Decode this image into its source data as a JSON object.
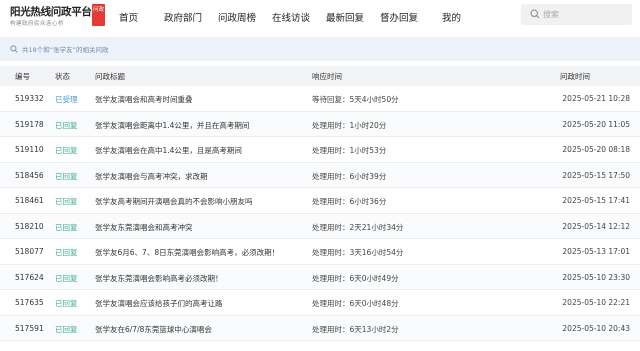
{
  "header": {
    "logo_title": "阳光热线问政平台",
    "logo_subtitle": "构建政府民众连心桥",
    "logo_seal": "问政",
    "nav": [
      {
        "label": "首页"
      },
      {
        "label": "政府部门"
      },
      {
        "label": "问政周榜"
      },
      {
        "label": "在线访谈"
      },
      {
        "label": "最新回复"
      },
      {
        "label": "督办回复"
      },
      {
        "label": "我的"
      }
    ],
    "search_placeholder": "搜索"
  },
  "notice": {
    "text": "共18个和“张学友”的相关问政"
  },
  "table": {
    "columns": [
      "编号",
      "状态",
      "问政标题",
      "响应时间",
      "问政时间"
    ],
    "rows": [
      {
        "id": "519332",
        "status": "已受理",
        "title": "张学友演唱会和高考时间重叠",
        "time": "等待回复：5天4小时50分",
        "date": "2025-05-21 10:28"
      },
      {
        "id": "519178",
        "status": "已回复",
        "title": "张学友演唱会距离中1.4公里，并且在高考期间",
        "time": "处理用时：1小时20分",
        "date": "2025-05-20 11:05"
      },
      {
        "id": "519110",
        "status": "已回复",
        "title": "张学友演唱会在高中1.4公里，且是高考期间",
        "time": "处理用时：1小时53分",
        "date": "2025-05-20 08:18"
      },
      {
        "id": "518456",
        "status": "已回复",
        "title": "张学友演唱会与高考冲突，求改期",
        "time": "处理用时：6小时39分",
        "date": "2025-05-15 17:50"
      },
      {
        "id": "518461",
        "status": "已回复",
        "title": "张学友高考期间开演唱会真的不会影响小朋友吗",
        "time": "处理用时：6小时36分",
        "date": "2025-05-15 17:41"
      },
      {
        "id": "518210",
        "status": "已回复",
        "title": "张学友东莞演唱会和高考冲突",
        "time": "处理用时：2天21小时34分",
        "date": "2025-05-14 12:12"
      },
      {
        "id": "518077",
        "status": "已回复",
        "title": "张学友6月6、7、8日东莞演唱会影响高考，必须改期！",
        "time": "处理用时：3天16小时54分",
        "date": "2025-05-13 17:01"
      },
      {
        "id": "517624",
        "status": "已回复",
        "title": "张学友东莞演唱会影响高考必须改期！",
        "time": "处理用时：6天0小时49分",
        "date": "2025-05-10 23:30"
      },
      {
        "id": "517635",
        "status": "已回复",
        "title": "张学友演唱会应该给孩子们的高考让路",
        "time": "处理用时：6天0小时48分",
        "date": "2025-05-10 22:21"
      },
      {
        "id": "517591",
        "status": "已回复",
        "title": "张学友在6/7/8东莞篮球中心演唱会",
        "time": "处理用时：6天13小时2分",
        "date": "2025-05-10 20:43"
      }
    ]
  },
  "colors": {
    "accent_red": "#e53935",
    "status_replied": "#3aaf8c",
    "status_accepted": "#4a9bd8"
  }
}
